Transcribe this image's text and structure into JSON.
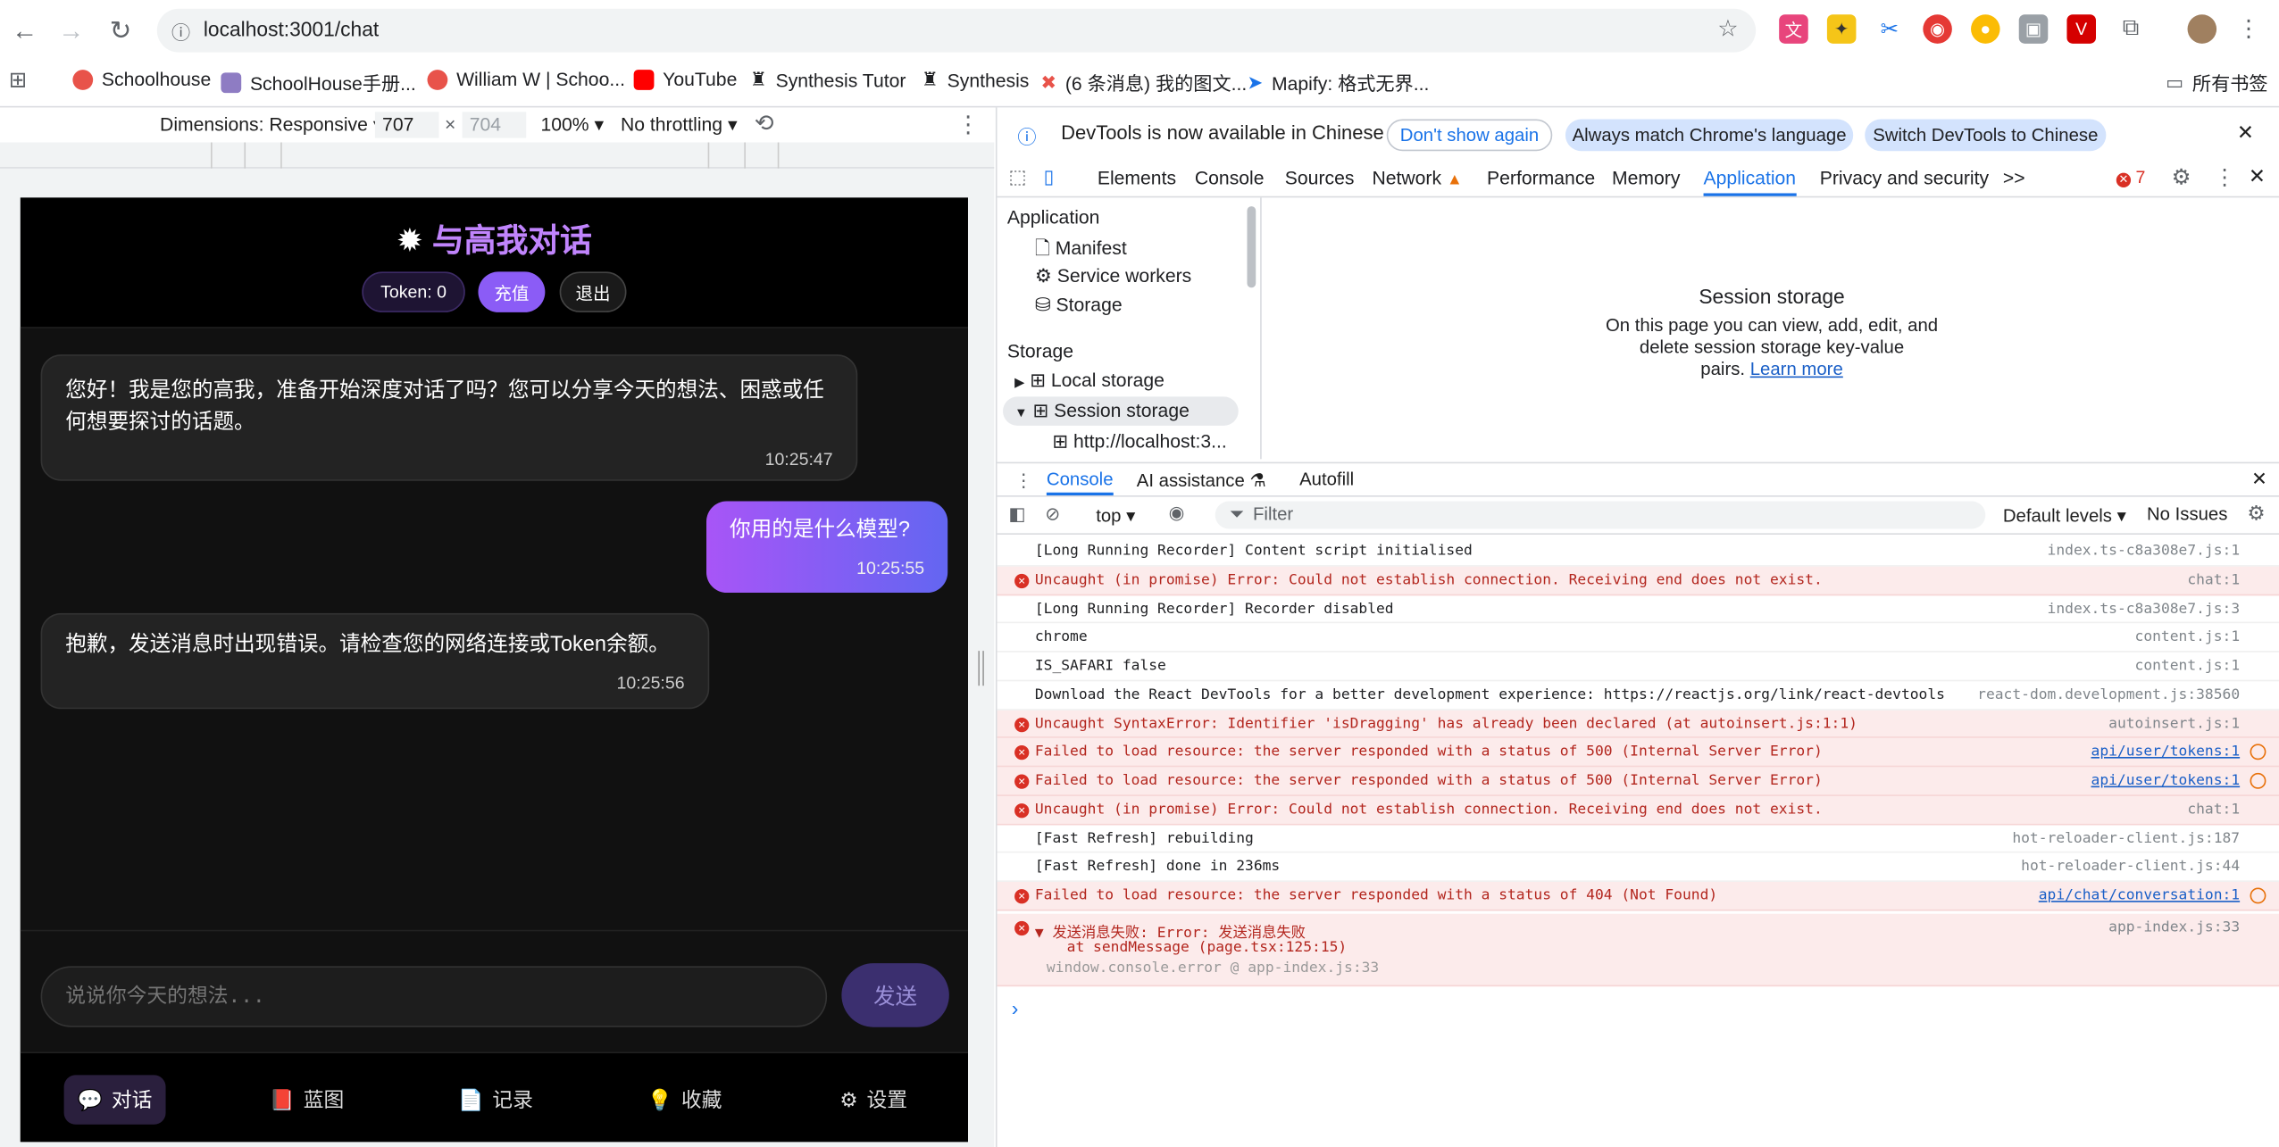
{
  "browser": {
    "url": "localhost:3001/chat",
    "bookmarks": [
      "Schoolhouse",
      "SchoolHouse手册...",
      "William W | Schoo...",
      "YouTube",
      "Synthesis Tutor",
      "Synthesis",
      "(6 条消息) 我的图文...",
      "Mapify: 格式无界..."
    ],
    "all_bookmarks": "所有书签"
  },
  "device_toolbar": {
    "dimensions_label": "Dimensions: Responsive ▾",
    "width": "707",
    "times": "×",
    "height": "704",
    "zoom": "100% ▾",
    "throttle": "No throttling ▾"
  },
  "app": {
    "title": "与高我对话",
    "title_icon": "✹",
    "token": "Token: 0",
    "recharge": "充值",
    "logout": "退出",
    "messages": [
      {
        "role": "assistant",
        "text": "您好！我是您的高我，准备开始深度对话了吗？您可以分享今天的想法、困惑或任何想要探讨的话题。",
        "time": "10:25:47"
      },
      {
        "role": "user",
        "text": "你用的是什么模型?",
        "time": "10:25:55"
      },
      {
        "role": "assistant",
        "text": "抱歉，发送消息时出现错误。请检查您的网络连接或Token余额。",
        "time": "10:25:56"
      }
    ],
    "input_placeholder": "说说你今天的想法...",
    "send": "发送",
    "nav": [
      {
        "icon": "💬",
        "label": "对话"
      },
      {
        "icon": "📕",
        "label": "蓝图"
      },
      {
        "icon": "📄",
        "label": "记录"
      },
      {
        "icon": "💡",
        "label": "收藏"
      },
      {
        "icon": "⚙",
        "label": "设置"
      }
    ]
  },
  "devtools": {
    "info": "DevTools is now available in Chinese",
    "dont_show": "Don't show again",
    "match_lang": "Always match Chrome's language",
    "switch": "Switch DevTools to Chinese",
    "tabs": [
      "Elements",
      "Console",
      "Sources",
      "Network",
      "Performance",
      "Memory",
      "Application",
      "Privacy and security"
    ],
    "more_tabs": ">>",
    "error_count": "7",
    "tree": {
      "application_header": "Application",
      "manifest": "Manifest",
      "service_workers": "Service workers",
      "storage_item": "Storage",
      "storage_header": "Storage",
      "local_storage": "Local storage",
      "session_storage": "Session storage",
      "session_origin": "http://localhost:3..."
    },
    "session_title": "Session storage",
    "session_desc1": "On this page you can view, add, edit, and",
    "session_desc2": "delete session storage key-value",
    "session_desc3": "pairs.",
    "learn_more": "Learn more",
    "drawer_tabs": [
      "Console",
      "AI assistance",
      "Autofill"
    ],
    "context": "top ▾",
    "filter": "Filter",
    "levels": "Default levels ▾",
    "issues": "No Issues",
    "logs": [
      {
        "err": false,
        "msg": "[Long Running Recorder] Content script initialised",
        "src": "index.ts-c8a308e7.js:1"
      },
      {
        "err": true,
        "msg": "Uncaught (in promise) Error: Could not establish connection. Receiving end does not exist.",
        "src": "chat:1"
      },
      {
        "err": false,
        "msg": "[Long Running Recorder] Recorder disabled",
        "src": "index.ts-c8a308e7.js:3"
      },
      {
        "err": false,
        "msg": "chrome",
        "src": "content.js:1"
      },
      {
        "err": false,
        "msg": "IS_SAFARI false",
        "src": "content.js:1"
      },
      {
        "err": false,
        "msg": "Download the React DevTools for a better development experience: https://reactjs.org/link/react-devtools",
        "src": "react-dom.development.js:38560"
      },
      {
        "err": true,
        "msg": "Uncaught SyntaxError: Identifier 'isDragging' has already been declared (at autoinsert.js:1:1)",
        "src": "autoinsert.js:1"
      },
      {
        "err": true,
        "msg": "Failed to load resource: the server responded with a status of 500 (Internal Server Error)",
        "src": "api/user/tokens:1"
      },
      {
        "err": true,
        "msg": "Failed to load resource: the server responded with a status of 500 (Internal Server Error)",
        "src": "api/user/tokens:1"
      },
      {
        "err": true,
        "msg": "Uncaught (in promise) Error: Could not establish connection. Receiving end does not exist.",
        "src": "chat:1"
      },
      {
        "err": false,
        "msg": "[Fast Refresh] rebuilding",
        "src": "hot-reloader-client.js:187"
      },
      {
        "err": false,
        "msg": "[Fast Refresh] done in 236ms",
        "src": "hot-reloader-client.js:44"
      },
      {
        "err": true,
        "msg": "Failed to load resource: the server responded with a status of 404 (Not Found)",
        "src": "api/chat/conversation:1"
      }
    ],
    "last_error": {
      "msg": "▼ 发送消息失败: Error: 发送消息失败",
      "stack": "at sendMessage (page.tsx:125:15)",
      "caller": "window.console.error @ app-index.js:33",
      "src": "app-index.js:33"
    },
    "prompt": "›"
  }
}
